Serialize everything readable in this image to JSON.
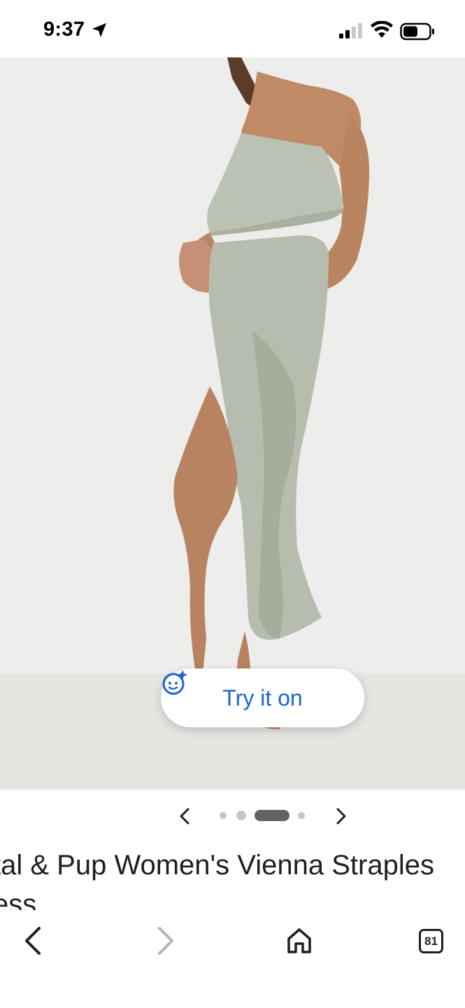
{
  "status_bar": {
    "time": "9:37",
    "icons": [
      "location-arrow-icon",
      "cellular-signal-icon",
      "wifi-icon",
      "battery-icon"
    ]
  },
  "product": {
    "image_description_icon": "product-photo",
    "try_on_label": "Try it on",
    "try_on_icon": "sparkle-face-icon",
    "title": "tal & Pup Women's Vienna Strapless Dress",
    "title_line1": "tal & Pup Women's Vienna Straples",
    "title_line2": "ess"
  },
  "carousel": {
    "total_dots": 4,
    "active_index": 2
  },
  "bottom_nav": {
    "tabs_count": "81"
  },
  "colors": {
    "accent": "#1a66d2",
    "dress": "#b9bfb0",
    "background_image": "#ededeb"
  }
}
